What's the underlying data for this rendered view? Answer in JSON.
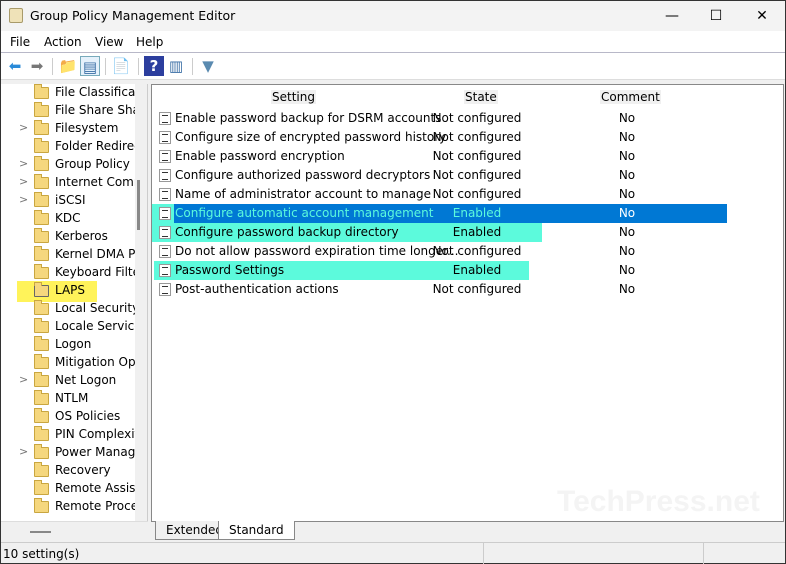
{
  "window": {
    "title": "Group Policy Management Editor",
    "minimize": "—",
    "maximize": "☐",
    "close": "✕"
  },
  "menu": [
    "File",
    "Action",
    "View",
    "Help"
  ],
  "toolbar": [
    {
      "icon": "back-arrow-icon",
      "g": "⬅"
    },
    {
      "icon": "forward-arrow-icon",
      "g": "➡"
    },
    {
      "icon": "up-folder-icon",
      "g": "📁"
    },
    {
      "icon": "show-hide-tree-icon",
      "g": "▤"
    },
    {
      "icon": "export-list-icon",
      "g": "📄"
    },
    {
      "icon": "help-icon",
      "g": "?"
    },
    {
      "icon": "show-action-pane-icon",
      "g": "▥"
    },
    {
      "icon": "filter-icon",
      "g": "▼"
    }
  ],
  "tree": [
    {
      "label": "File Classificat",
      "exp": false
    },
    {
      "label": "File Share Shad",
      "exp": false
    },
    {
      "label": "Filesystem",
      "exp": true
    },
    {
      "label": "Folder Redirec",
      "exp": false
    },
    {
      "label": "Group Policy",
      "exp": true
    },
    {
      "label": "Internet Comm",
      "exp": true
    },
    {
      "label": "iSCSI",
      "exp": true
    },
    {
      "label": "KDC",
      "exp": false
    },
    {
      "label": "Kerberos",
      "exp": false
    },
    {
      "label": "Kernel DMA P",
      "exp": false
    },
    {
      "label": "Keyboard Filte",
      "exp": false
    },
    {
      "label": "LAPS",
      "exp": false,
      "selected": true
    },
    {
      "label": "Local Security",
      "exp": false
    },
    {
      "label": "Locale Service",
      "exp": false
    },
    {
      "label": "Logon",
      "exp": false
    },
    {
      "label": "Mitigation Op",
      "exp": false
    },
    {
      "label": "Net Logon",
      "exp": true
    },
    {
      "label": "NTLM",
      "exp": false
    },
    {
      "label": "OS Policies",
      "exp": false
    },
    {
      "label": "PIN Complexit",
      "exp": false
    },
    {
      "label": "Power Manag",
      "exp": true
    },
    {
      "label": "Recovery",
      "exp": false
    },
    {
      "label": "Remote Assist",
      "exp": false
    },
    {
      "label": "Remote Proce",
      "exp": false
    }
  ],
  "columns": {
    "setting": "Setting",
    "state": "State",
    "comment": "Comment"
  },
  "settings": [
    {
      "name": "Enable password backup for DSRM accounts",
      "state": "Not configured",
      "comment": "No"
    },
    {
      "name": "Configure size of encrypted password history",
      "state": "Not configured",
      "comment": "No"
    },
    {
      "name": "Enable password encryption",
      "state": "Not configured",
      "comment": "No"
    },
    {
      "name": "Configure authorized password decryptors",
      "state": "Not configured",
      "comment": "No"
    },
    {
      "name": "Name of administrator account to manage",
      "state": "Not configured",
      "comment": "No"
    },
    {
      "name": "Configure automatic account management",
      "state": "Enabled",
      "comment": "No",
      "selected": true
    },
    {
      "name": "Configure password backup directory",
      "state": "Enabled",
      "comment": "No",
      "highlight": true
    },
    {
      "name": "Do not allow password expiration time longer...",
      "state": "Not configured",
      "comment": "No"
    },
    {
      "name": "Password Settings",
      "state": "Enabled",
      "comment": "No",
      "highlight": true
    },
    {
      "name": "Post-authentication actions",
      "state": "Not configured",
      "comment": "No"
    }
  ],
  "tabs": [
    "Extended",
    "Standard"
  ],
  "status": "10 setting(s)",
  "watermark": "TechPress.net",
  "colors": {
    "selected": "#0078d4",
    "highlight": "#5cfadc",
    "laps_highlight": "#fff35a"
  }
}
